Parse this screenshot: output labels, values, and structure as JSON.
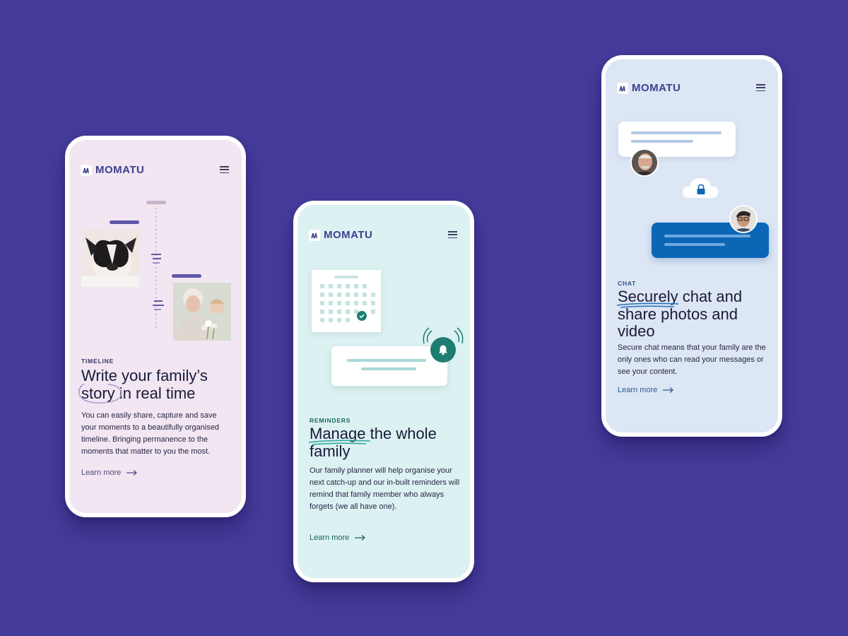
{
  "brand": "MOMATU",
  "colors": {
    "background": "#453b9b",
    "timeline_bg": "#f1e6f1",
    "reminders_bg": "#dcf1f1",
    "chat_bg": "#dce6f4",
    "timeline_accent": "#5e58a8",
    "reminders_accent": "#1e7d71",
    "chat_accent": "#0b67b6"
  },
  "screens": [
    {
      "eyebrow": "TIMELINE",
      "title_highlight": "story",
      "title_line1": "Write your family’s",
      "title_rest": " in real time",
      "body": "You can easily share, capture and save your moments to a beautifully organised timeline. Bringing permanence to the moments that matter to you the most.",
      "cta": "Learn more",
      "icons": [
        "menu-icon",
        "arrow-right-icon"
      ]
    },
    {
      "eyebrow": "REMINDERS",
      "title_highlight": "Manage",
      "title_rest": " the whole family",
      "body": "Our family planner will help organise your next catch-up and our in-built reminders will remind that family member who always forgets (we all have one).",
      "cta": "Learn more",
      "icons": [
        "menu-icon",
        "calendar-icon",
        "check-icon",
        "bell-icon",
        "arrow-right-icon"
      ]
    },
    {
      "eyebrow": "CHAT",
      "title_highlight": "Securely",
      "title_rest": " chat and share photos and video",
      "body": "Secure chat means that your family are the only ones who can read your messages or see your content.",
      "cta": "Learn more",
      "icons": [
        "menu-icon",
        "lock-icon",
        "cloud-icon",
        "arrow-right-icon"
      ]
    }
  ]
}
